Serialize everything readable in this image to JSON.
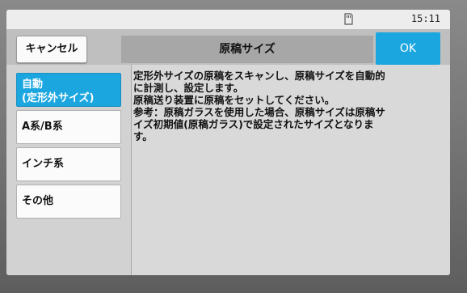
{
  "status": {
    "icon": "sd-card-icon",
    "time": "15:11"
  },
  "header": {
    "cancel_label": "キャンセル",
    "title": "原稿サイズ",
    "ok_label": "OK"
  },
  "sidebar": {
    "items": [
      {
        "line1": "自動",
        "line2": "(定形外サイズ)",
        "selected": true
      },
      {
        "line1": "A系/B系",
        "line2": "",
        "selected": false
      },
      {
        "line1": "インチ系",
        "line2": "",
        "selected": false
      },
      {
        "line1": "その他",
        "line2": "",
        "selected": false
      }
    ]
  },
  "main": {
    "lines": [
      "定形外サイズの原稿をスキャンし、原稿サイズを自動的",
      "に計測し、設定します。",
      "原稿送り装置に原稿をセットしてください。",
      "参考：原稿ガラスを使用した場合、原稿サイズは原稿サ",
      "イズ初期値(原稿ガラス)で設定されたサイズとなりま",
      "す。"
    ]
  },
  "colors": {
    "accent": "#1ba6e0",
    "screen_bg": "#d9d9d9"
  }
}
